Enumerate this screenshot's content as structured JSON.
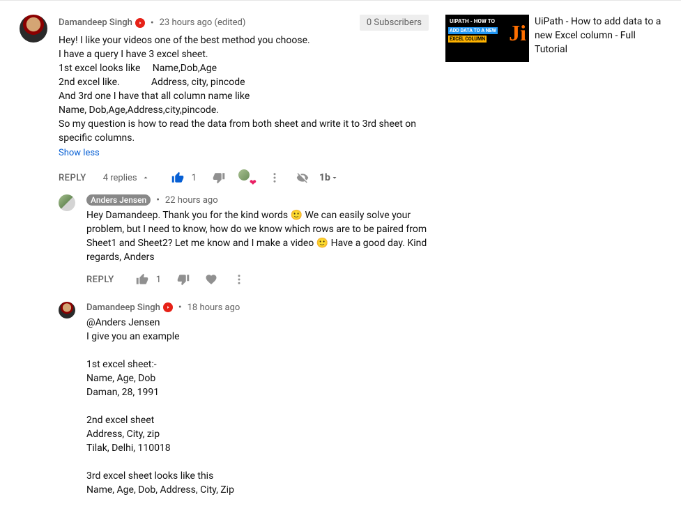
{
  "comment": {
    "author": "Damandeep Singh",
    "timestamp": "23 hours ago (edited)",
    "subscriber_badge": "0 Subscribers",
    "body": "Hey! I like your videos one of the best method you choose.\nI have a query I have 3 excel sheet.\n1st excel looks like     Name,Dob,Age\n2nd excel like.             Address, city, pincode\nAnd 3rd one I have that all column name like\nName, Dob,Age,Address,city,pincode.\nSo my question is how to read the data from both sheet and write it to 3rd sheet on specific columns.",
    "show_less": "Show less",
    "reply_label": "REPLY",
    "replies_label": "4 replies",
    "like_count": "1"
  },
  "replies": [
    {
      "author": "Anders Jensen",
      "author_style": "pill",
      "timestamp": "22 hours ago",
      "body": "Hey Damandeep. Thank you for the kind words 🙂 We can easily solve your problem, but I need to know, how do we know which rows are to be paired from Sheet1 and Sheet2? Let me know and I make a video 🙂 Have a good day. Kind regards, Anders",
      "reply_label": "REPLY",
      "like_count": "1"
    },
    {
      "author": "Damandeep Singh",
      "author_style": "plain",
      "timestamp": "18 hours ago",
      "body": "@Anders Jensen\nI give you an example\n\n1st excel sheet:-\nName, Age, Dob\nDaman, 28, 1991\n\n2nd excel sheet\nAddress, City, zip\nTilak, Delhi, 110018\n\n3rd excel sheet looks like this\nName, Age, Dob, Address, City, Zip"
    }
  ],
  "related_video": {
    "thumb_line1": "UIPATH - HOW TO",
    "thumb_line2": "ADD DATA TO A NEW",
    "thumb_line3": "EXCEL COLUMN",
    "thumb_logo": "Ji",
    "title": "UiPath - How to add data to a new Excel column - Full Tutorial"
  }
}
